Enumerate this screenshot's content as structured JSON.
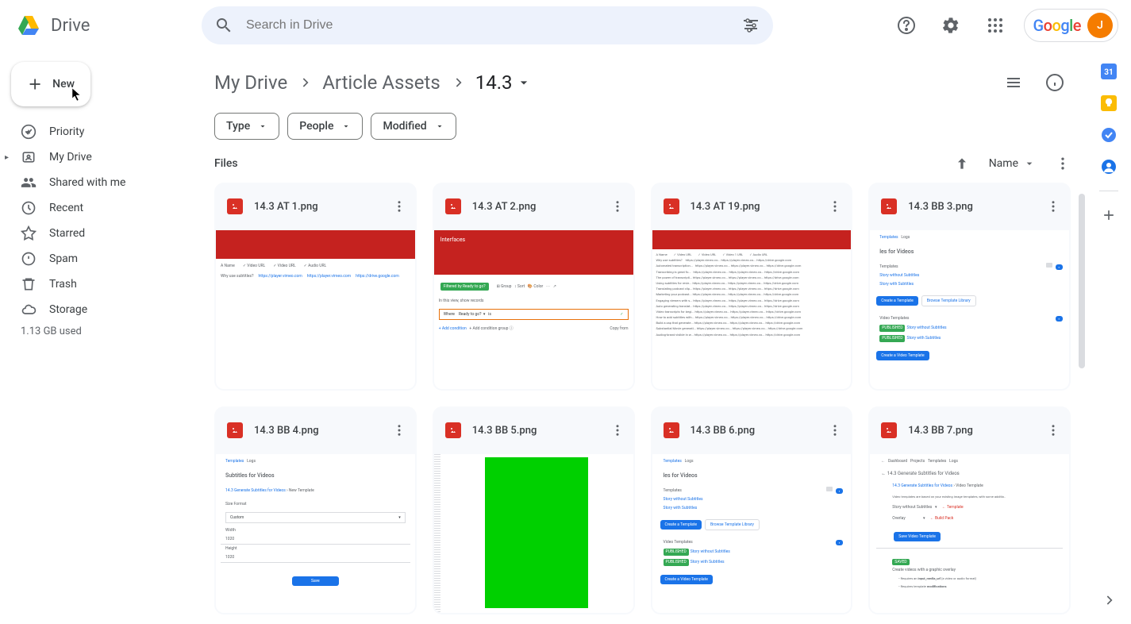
{
  "app": {
    "name": "Drive"
  },
  "search": {
    "placeholder": "Search in Drive"
  },
  "google": {
    "text": "Google",
    "avatar_initial": "J"
  },
  "sidebar": {
    "new_label": "New",
    "items": [
      {
        "label": "Priority"
      },
      {
        "label": "My Drive"
      },
      {
        "label": "Shared with me"
      },
      {
        "label": "Recent"
      },
      {
        "label": "Starred"
      },
      {
        "label": "Spam"
      },
      {
        "label": "Trash"
      },
      {
        "label": "Storage"
      }
    ],
    "storage_used": "1.13 GB used"
  },
  "breadcrumb": {
    "items": [
      "My Drive",
      "Article Assets",
      "14.3"
    ]
  },
  "filters": {
    "type": "Type",
    "people": "People",
    "modified": "Modified"
  },
  "section": {
    "title": "Files",
    "sort": "Name"
  },
  "files": [
    {
      "name": "14.3 AT 1.png"
    },
    {
      "name": "14.3 AT 2.png"
    },
    {
      "name": "14.3 AT 19.png"
    },
    {
      "name": "14.3 BB 3.png"
    },
    {
      "name": "14.3 BB 4.png"
    },
    {
      "name": "14.3 BB 5.png"
    },
    {
      "name": "14.3 BB 6.png"
    },
    {
      "name": "14.3 BB 7.png"
    }
  ]
}
